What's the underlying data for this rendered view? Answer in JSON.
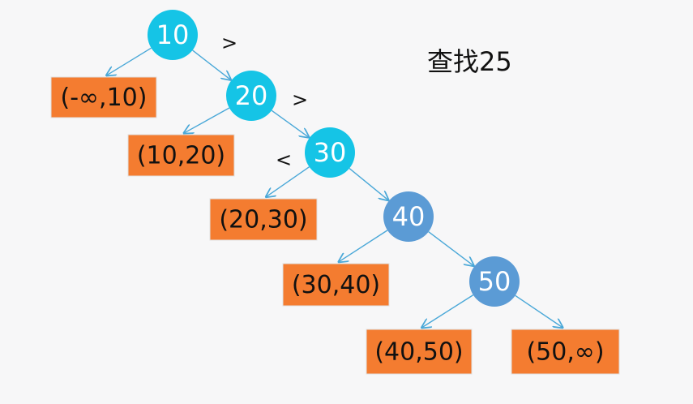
{
  "title": "查找25",
  "colors": {
    "visited_node": "#15c4e6",
    "unvisited_node": "#5b9bd5",
    "leaf_fill": "#f47c30",
    "leaf_border": "#e0e0e0",
    "edge": "#4aa8d8",
    "background": "#f7f7f8"
  },
  "nodes": [
    {
      "id": "n10",
      "label": "10",
      "state": "visited"
    },
    {
      "id": "n20",
      "label": "20",
      "state": "visited"
    },
    {
      "id": "n30",
      "label": "30",
      "state": "visited"
    },
    {
      "id": "n40",
      "label": "40",
      "state": "unvisited"
    },
    {
      "id": "n50",
      "label": "50",
      "state": "unvisited"
    }
  ],
  "leaves": [
    {
      "id": "l1",
      "label": "(-∞,10)"
    },
    {
      "id": "l2",
      "label": "(10,20)"
    },
    {
      "id": "l3",
      "label": "(20,30)"
    },
    {
      "id": "l4",
      "label": "(30,40)"
    },
    {
      "id": "l5",
      "label": "(40,50)"
    },
    {
      "id": "l6",
      "label": "(50,∞)"
    }
  ],
  "edges": [
    {
      "from": "n10",
      "to": "l1"
    },
    {
      "from": "n10",
      "to": "n20"
    },
    {
      "from": "n20",
      "to": "l2"
    },
    {
      "from": "n20",
      "to": "n30"
    },
    {
      "from": "n30",
      "to": "l3"
    },
    {
      "from": "n30",
      "to": "n40"
    },
    {
      "from": "n40",
      "to": "l4"
    },
    {
      "from": "n40",
      "to": "n50"
    },
    {
      "from": "n50",
      "to": "l5"
    },
    {
      "from": "n50",
      "to": "l6"
    }
  ],
  "comparisons": [
    {
      "id": "c1",
      "label": ">"
    },
    {
      "id": "c2",
      "label": ">"
    },
    {
      "id": "c3",
      "label": "<"
    }
  ]
}
